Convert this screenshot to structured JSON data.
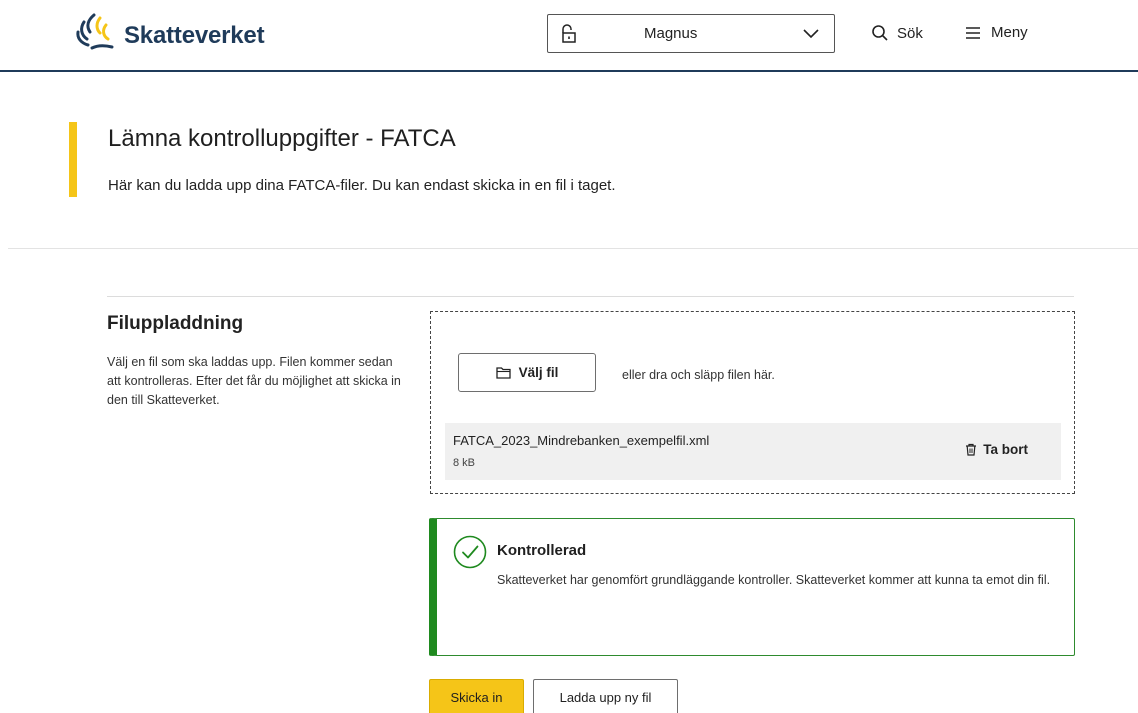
{
  "header": {
    "brand": "Skatteverket",
    "account_name": "Magnus",
    "search_label": "Sök",
    "menu_label": "Meny"
  },
  "page": {
    "title": "Lämna kontrolluppgifter - FATCA",
    "intro": "Här kan du ladda upp dina FATCA-filer. Du kan endast skicka in en fil i taget."
  },
  "upload_section": {
    "heading": "Filuppladdning",
    "description": "Välj en fil som ska laddas upp. Filen kommer sedan att kontrolleras. Efter det får du möjlighet att skicka in den till Skatteverket.",
    "choose_button": "Välj fil",
    "drop_hint": "eller dra och släpp filen här.",
    "file": {
      "name": "FATCA_2023_Mindrebanken_exempelfil.xml",
      "size": "8 kB",
      "remove_label": "Ta bort"
    }
  },
  "status": {
    "title": "Kontrollerad",
    "text": "Skatteverket har genomfört grundläggande kontroller. Skatteverket kommer att kunna ta emot din fil.",
    "color": "#1f8a1f"
  },
  "actions": {
    "submit_label": "Skicka in",
    "upload_new_label": "Ladda upp ny fil"
  },
  "colors": {
    "brand_navy": "#1f3b5a",
    "accent_yellow": "#f5c518",
    "success_green": "#1f8a1f"
  },
  "icons": {
    "logo": "skatteverket-logo-icon",
    "account": "lock-icon",
    "dropdown": "chevron-down-icon",
    "search": "search-icon",
    "menu": "hamburger-icon",
    "choose_file": "folder-icon",
    "remove": "trash-icon",
    "status": "check-circle-icon"
  }
}
